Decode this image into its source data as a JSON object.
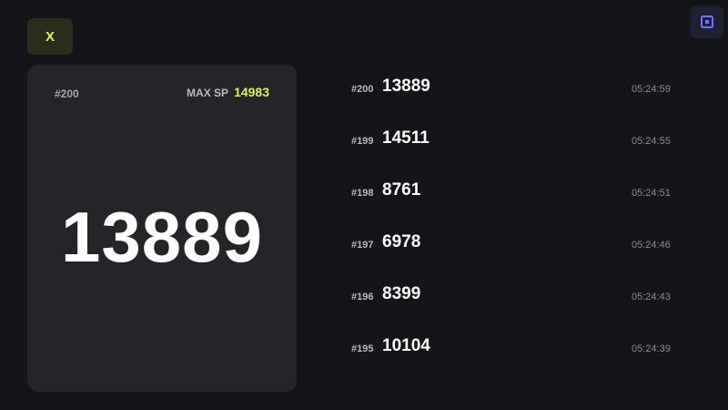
{
  "close_button": {
    "label": "X",
    "icon": "close-icon"
  },
  "corner_button": {
    "icon": "square-dot-icon"
  },
  "current": {
    "id": "#200",
    "max_label": "MAX SP",
    "max_value": "14983",
    "value": "13889"
  },
  "history": [
    {
      "id": "#200",
      "value": "13889",
      "time": "05:24:59"
    },
    {
      "id": "#199",
      "value": "14511",
      "time": "05:24:55"
    },
    {
      "id": "#198",
      "value": "8761",
      "time": "05:24:51"
    },
    {
      "id": "#197",
      "value": "6978",
      "time": "05:24:46"
    },
    {
      "id": "#196",
      "value": "8399",
      "time": "05:24:43"
    },
    {
      "id": "#195",
      "value": "10104",
      "time": "05:24:39"
    }
  ],
  "colors": {
    "background": "#141518",
    "card": "#242528",
    "accent": "#dff05a",
    "corner_button": "#1f2133",
    "corner_icon": "#6c73ff"
  }
}
